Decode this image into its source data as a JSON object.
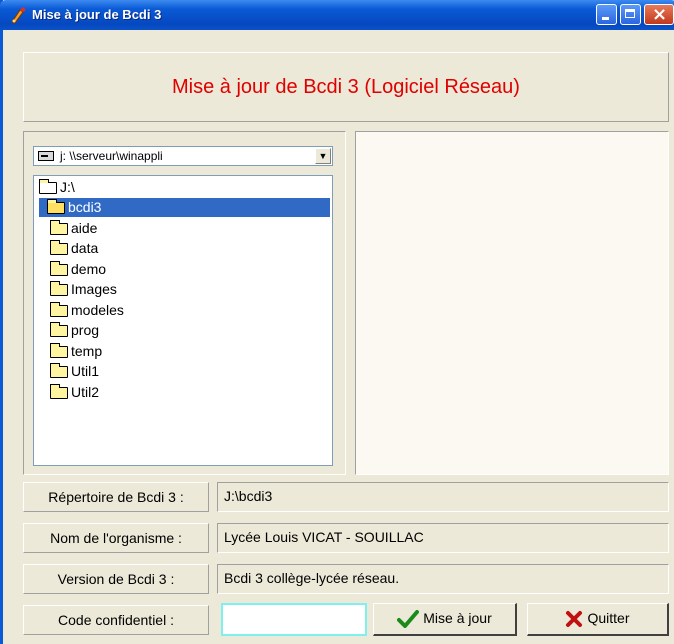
{
  "window": {
    "title": "Mise à jour de Bcdi 3"
  },
  "header": {
    "title": "Mise à jour de Bcdi 3 (Logiciel Réseau)",
    "title_color": "#e00000"
  },
  "drive": {
    "selected": "j: \\\\serveur\\winappli",
    "icon": "network-drive-icon"
  },
  "tree": {
    "items": [
      {
        "label": "J:\\",
        "state": "open"
      },
      {
        "label": "bcdi3",
        "state": "open-selected"
      },
      {
        "label": "aide",
        "state": "closed"
      },
      {
        "label": "data",
        "state": "closed"
      },
      {
        "label": "demo",
        "state": "closed"
      },
      {
        "label": "Images",
        "state": "closed"
      },
      {
        "label": "modeles",
        "state": "closed"
      },
      {
        "label": "prog",
        "state": "closed"
      },
      {
        "label": "temp",
        "state": "closed"
      },
      {
        "label": "Util1",
        "state": "closed"
      },
      {
        "label": "Util2",
        "state": "closed"
      }
    ],
    "selected_color": "#316ac5"
  },
  "fields": {
    "repertoire_label": "Répertoire de Bcdi 3 :",
    "repertoire_value": "J:\\bcdi3",
    "organisme_label": "Nom de l'organisme :",
    "organisme_value": "Lycée Louis VICAT - SOUILLAC",
    "version_label": "Version de Bcdi 3 :",
    "version_value": "Bcdi 3 collège-lycée réseau.",
    "code_label": "Code confidentiel :",
    "code_value": ""
  },
  "buttons": {
    "update_label": "Mise à jour",
    "update_icon": "check-icon",
    "quit_label": "Quitter",
    "quit_icon": "x-icon"
  }
}
